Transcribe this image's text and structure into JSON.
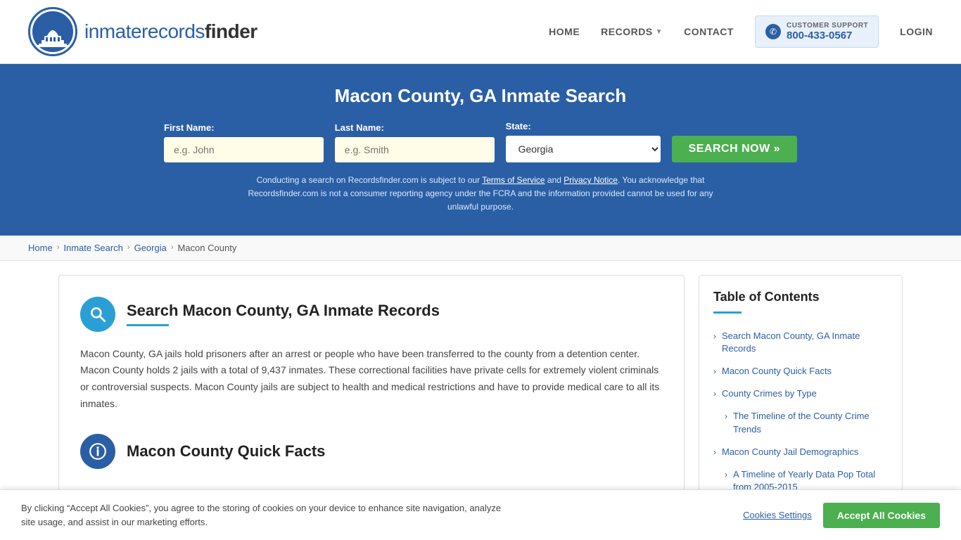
{
  "site": {
    "logo_text_main": "inmaterecords",
    "logo_text_bold": "finder"
  },
  "nav": {
    "home": "HOME",
    "records": "RECORDS",
    "contact": "CONTACT",
    "support_label": "CUSTOMER SUPPORT",
    "support_number": "800-433-0567",
    "login": "LOGIN"
  },
  "hero": {
    "title": "Macon County, GA Inmate Search",
    "first_name_label": "First Name:",
    "first_name_placeholder": "e.g. John",
    "last_name_label": "Last Name:",
    "last_name_placeholder": "e.g. Smith",
    "state_label": "State:",
    "state_value": "Georgia",
    "search_button": "SEARCH NOW »",
    "disclaimer": "Conducting a search on Recordsfinder.com is subject to our Terms of Service and Privacy Notice. You acknowledge that Recordsfinder.com is not a consumer reporting agency under the FCRA and the information provided cannot be used for any unlawful purpose.",
    "terms_link": "Terms of Service",
    "privacy_link": "Privacy Notice"
  },
  "breadcrumb": {
    "home": "Home",
    "inmate_search": "Inmate Search",
    "georgia": "Georgia",
    "current": "Macon County"
  },
  "main_section": {
    "title": "Search Macon County, GA Inmate Records",
    "body": "Macon County, GA jails hold prisoners after an arrest or people who have been transferred to the county from a detention center. Macon County holds 2 jails with a total of 9,437 inmates. These correctional facilities have private cells for extremely violent criminals or controversial suspects. Macon County jails are subject to health and medical restrictions and have to provide medical care to all its inmates."
  },
  "quick_facts": {
    "title": "Macon County Quick Facts"
  },
  "toc": {
    "title": "Table of Contents",
    "items": [
      {
        "label": "Search Macon County, GA Inmate Records",
        "sub": false
      },
      {
        "label": "Macon County Quick Facts",
        "sub": false
      },
      {
        "label": "County Crimes by Type",
        "sub": false
      },
      {
        "label": "The Timeline of the County Crime Trends",
        "sub": true
      },
      {
        "label": "Macon County Jail Demographics",
        "sub": false
      },
      {
        "label": "A Timeline of Yearly Data Pop Total from 2005-2015",
        "sub": true
      }
    ]
  },
  "cookie_banner": {
    "text": "By clicking “Accept All Cookies”, you agree to the storing of cookies on your device to enhance site navigation, analyze site usage, and assist in our marketing efforts.",
    "settings_label": "Cookies Settings",
    "accept_label": "Accept All Cookies"
  },
  "colors": {
    "primary_blue": "#2a5fa5",
    "hero_bg": "#2a5fa5",
    "search_icon_bg": "#2a9fd6",
    "green": "#4caf50"
  }
}
